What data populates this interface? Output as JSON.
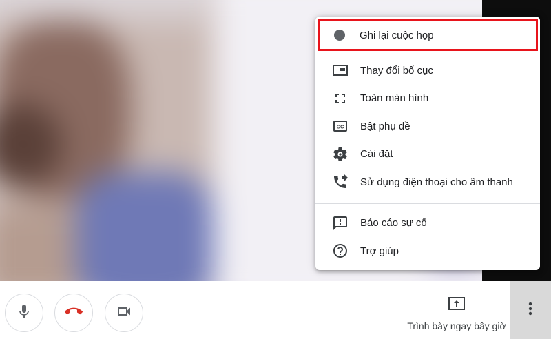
{
  "menu": {
    "items": [
      {
        "label": "Ghi lại cuộc họp",
        "icon": "record-dot-icon"
      },
      {
        "label": "Thay đổi bố cục",
        "icon": "layout-icon"
      },
      {
        "label": "Toàn màn hình",
        "icon": "fullscreen-icon"
      },
      {
        "label": "Bật phụ đề",
        "icon": "captions-icon"
      },
      {
        "label": "Cài đặt",
        "icon": "gear-icon"
      },
      {
        "label": "Sử dụng điện thoại cho âm thanh",
        "icon": "phone-forward-icon"
      },
      {
        "label": "Báo cáo sự cố",
        "icon": "report-problem-icon"
      },
      {
        "label": "Trợ giúp",
        "icon": "help-icon"
      }
    ],
    "highlight_color": "#e8141c"
  },
  "bottom_bar": {
    "present_label": "Trình bày ngay bây giờ",
    "hangup_color": "#d93025"
  }
}
